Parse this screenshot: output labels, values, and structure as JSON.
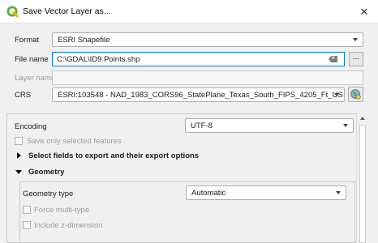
{
  "window": {
    "title": "Save Vector Layer as...",
    "close_glyph": "✕"
  },
  "form": {
    "format_label": "Format",
    "format_value": "ESRI Shapefile",
    "filename_label": "File name",
    "filename_value": "C:\\GDAL\\ID9 Points.shp",
    "browse_label": "...",
    "layername_label": "Layer name",
    "crs_label": "CRS",
    "crs_value": "ESRI:103548 - NAD_1983_CORS96_StatePlane_Texas_South_FIPS_4205_Ft_US"
  },
  "options": {
    "encoding_label": "Encoding",
    "encoding_value": "UTF-8",
    "save_selected_label": "Save only selected features",
    "select_fields_label": "Select fields to export and their export options",
    "geometry_label": "Geometry",
    "geometry_type_label": "Geometry type",
    "geometry_type_value": "Automatic",
    "force_multi_label": "Force multi-type",
    "include_z_label": "Include z-dimension"
  },
  "colors": {
    "accent": "#0078d7",
    "qgis_green": "#5aac3c"
  }
}
